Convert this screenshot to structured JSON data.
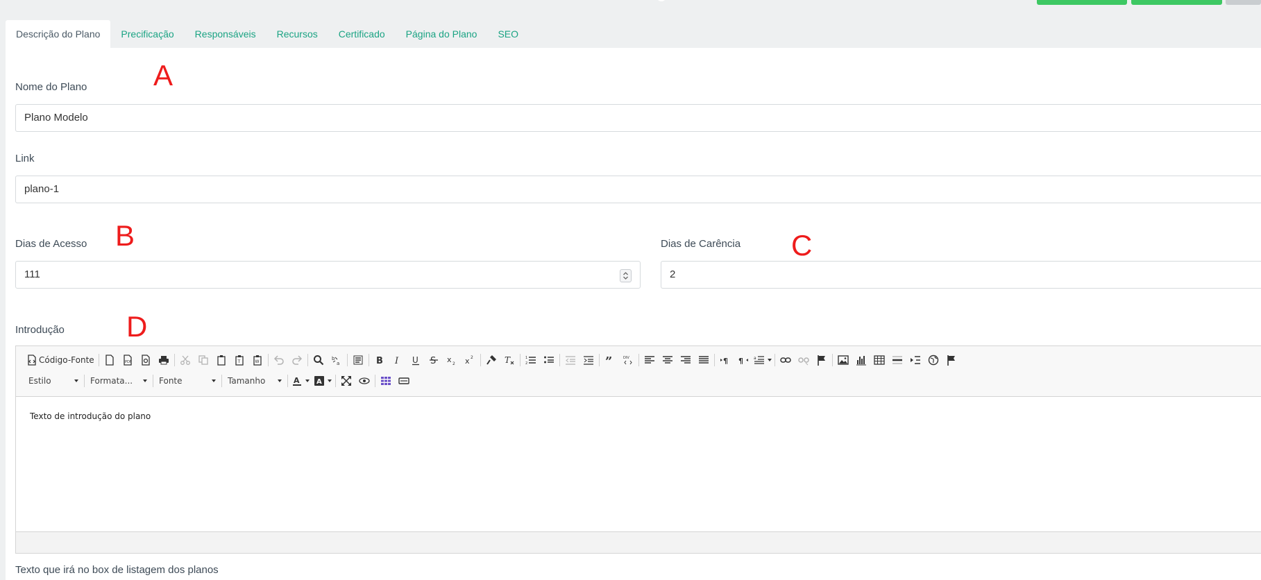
{
  "tabs": [
    {
      "label": "Descrição do Plano",
      "active": true
    },
    {
      "label": "Precificação"
    },
    {
      "label": "Responsáveis"
    },
    {
      "label": "Recursos"
    },
    {
      "label": "Certificado"
    },
    {
      "label": "Página do Plano"
    },
    {
      "label": "SEO"
    }
  ],
  "form": {
    "nome_label": "Nome do Plano",
    "nome_value": "Plano Modelo",
    "link_label": "Link",
    "link_value": "plano-1",
    "dias_acesso_label": "Dias de Acesso",
    "dias_acesso_value": "111",
    "dias_carencia_label": "Dias de Carência",
    "dias_carencia_value": "2",
    "introducao_label": "Introdução",
    "box_label": "Texto que irá no box de listagem dos planos"
  },
  "annotations": {
    "a": "A",
    "b": "B",
    "c": "C",
    "d": "D"
  },
  "editor": {
    "source_label": "Código-Fonte",
    "style_combo": "Estilo",
    "format_combo": "Formata...",
    "font_combo": "Fonte",
    "size_combo": "Tamanho",
    "content": "Texto de introdução do plano"
  },
  "colors": {
    "accent": "#1aa383",
    "top_buttons": "#3dc863",
    "annotation": "#ee1c1c",
    "page_bg": "#eef0f1"
  }
}
